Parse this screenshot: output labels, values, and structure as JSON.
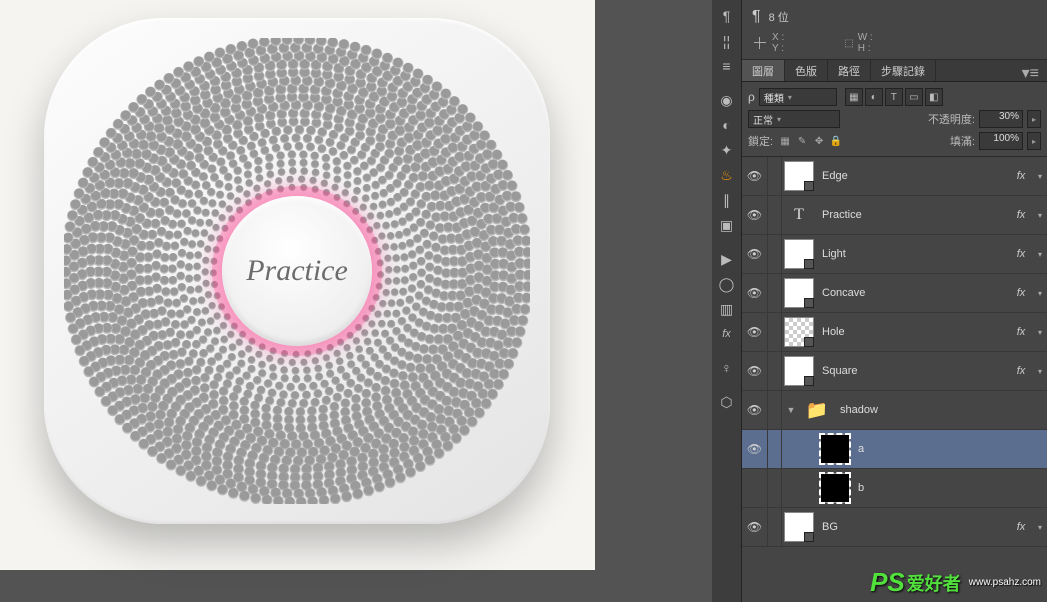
{
  "canvas": {
    "icon_text": "Practice"
  },
  "info": {
    "bitdepth": "8 位",
    "x_label": "X :",
    "y_label": "Y :",
    "w_label": "W :",
    "h_label": "H :"
  },
  "panel_tabs": {
    "layers": "圖層",
    "channels": "色版",
    "paths": "路徑",
    "history": "步驟記錄"
  },
  "controls": {
    "kind_label": "種類",
    "blend_mode": "正常",
    "opacity_label": "不透明度:",
    "opacity_value": "30%",
    "lock_label": "鎖定:",
    "fill_label": "填滿:",
    "fill_value": "100%"
  },
  "layers": [
    {
      "name": "Edge",
      "type": "shape",
      "fx": true,
      "visible": true
    },
    {
      "name": "Practice",
      "type": "text",
      "fx": true,
      "visible": true
    },
    {
      "name": "Light",
      "type": "shape",
      "fx": true,
      "visible": true
    },
    {
      "name": "Concave",
      "type": "shape",
      "fx": true,
      "visible": true
    },
    {
      "name": "Hole",
      "type": "hole",
      "fx": true,
      "visible": true
    },
    {
      "name": "Square",
      "type": "shape",
      "fx": true,
      "visible": true
    },
    {
      "name": "shadow",
      "type": "folder",
      "fx": false,
      "visible": true,
      "expanded": true
    },
    {
      "name": "a",
      "type": "mask",
      "fx": false,
      "visible": true,
      "selected": true,
      "sub": true
    },
    {
      "name": "b",
      "type": "mask",
      "fx": false,
      "visible": false,
      "sub": true
    },
    {
      "name": "BG",
      "type": "shape",
      "fx": true,
      "visible": true
    }
  ],
  "watermark": {
    "brand_prefix": "PS",
    "brand_text": "爱好者",
    "url": "www.psahz.com"
  }
}
